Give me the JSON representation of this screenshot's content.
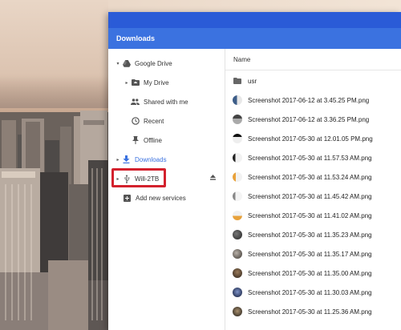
{
  "window": {
    "title": "Downloads"
  },
  "sidebar": {
    "items": [
      {
        "label": "Google Drive",
        "icon": "google-drive-icon",
        "arrow": "▾"
      },
      {
        "label": "My Drive",
        "icon": "folder-drive-icon",
        "arrow": "▸"
      },
      {
        "label": "Shared with me",
        "icon": "people-icon",
        "arrow": ""
      },
      {
        "label": "Recent",
        "icon": "clock-icon",
        "arrow": ""
      },
      {
        "label": "Offline",
        "icon": "pin-icon",
        "arrow": ""
      },
      {
        "label": "Downloads",
        "icon": "download-icon",
        "arrow": "▸"
      },
      {
        "label": "Will-2TB",
        "icon": "usb-icon",
        "arrow": "▸"
      },
      {
        "label": "Add new services",
        "icon": "plus-box-icon",
        "arrow": ""
      }
    ]
  },
  "file_list": {
    "column_name": "Name",
    "rows": [
      {
        "name": "usr",
        "type": "folder"
      },
      {
        "name": "Screenshot 2017-06-12 at 3.45.25 PM.png",
        "type": "image"
      },
      {
        "name": "Screenshot 2017-06-12 at 3.36.25 PM.png",
        "type": "image"
      },
      {
        "name": "Screenshot 2017-05-30 at 12.01.05 PM.png",
        "type": "image"
      },
      {
        "name": "Screenshot 2017-05-30 at 11.57.53 AM.png",
        "type": "image"
      },
      {
        "name": "Screenshot 2017-05-30 at 11.53.24 AM.png",
        "type": "image"
      },
      {
        "name": "Screenshot 2017-05-30 at 11.45.42 AM.png",
        "type": "image"
      },
      {
        "name": "Screenshot 2017-05-30 at 11.41.02 AM.png",
        "type": "image"
      },
      {
        "name": "Screenshot 2017-05-30 at 11.35.23 AM.png",
        "type": "image"
      },
      {
        "name": "Screenshot 2017-05-30 at 11.35.17 AM.png",
        "type": "image"
      },
      {
        "name": "Screenshot 2017-05-30 at 11.35.00 AM.png",
        "type": "image"
      },
      {
        "name": "Screenshot 2017-05-30 at 11.30.03 AM.png",
        "type": "image"
      },
      {
        "name": "Screenshot 2017-05-30 at 11.25.36 AM.png",
        "type": "image"
      }
    ]
  },
  "colors": {
    "accent": "#3b72e0",
    "highlight_box": "#d3212d"
  }
}
